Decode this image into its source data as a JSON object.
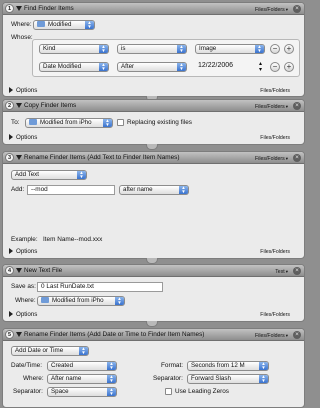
{
  "actions": [
    {
      "number": "1",
      "title": "Find Finder Items",
      "io": "Files/Folders",
      "where_label": "Where:",
      "where_value": "Modified",
      "whose_label": "Whose:",
      "conditions": [
        {
          "field": "Kind",
          "op": "is",
          "value": "Image"
        },
        {
          "field": "Date Modified",
          "op": "After",
          "value": "12/22/2006"
        }
      ],
      "options_label": "Options",
      "footer_io": "Files/Folders"
    },
    {
      "number": "2",
      "title": "Copy Finder Items",
      "io": "Files/Folders",
      "to_label": "To:",
      "to_value": "Modified from iPho",
      "replace_label": "Replacing existing files",
      "options_label": "Options",
      "footer_io": "Files/Folders"
    },
    {
      "number": "3",
      "title": "Rename Finder Items (Add Text to Finder Item Names)",
      "io": "Files/Folders",
      "mode": "Add Text",
      "add_label": "Add:",
      "add_value": "--mod",
      "position": "after name",
      "example_label": "Example:",
      "example_value": "Item Name--mod.xxx",
      "options_label": "Options",
      "footer_io": "Files/Folders"
    },
    {
      "number": "4",
      "title": "New Text File",
      "io": "Text",
      "save_as_label": "Save as:",
      "save_as_value": "0 Last RunDate.txt",
      "where_label": "Where:",
      "where_value": "Modified from iPho",
      "options_label": "Options",
      "footer_io": "Files/Folders"
    },
    {
      "number": "5",
      "title": "Rename Finder Items (Add Date or Time to Finder Item Names)",
      "io": "Files/Folders",
      "mode": "Add Date or Time",
      "date_time_label": "Date/Time:",
      "date_time_value": "Created",
      "format_label": "Format:",
      "format_value": "Seconds from 12 M",
      "where_label": "Where:",
      "where_value": "After name",
      "separator_label": "Separator:",
      "separator_value": "Forward Slash",
      "separator2_label": "Separator:",
      "separator2_value": "Space",
      "leading_zeros_label": "Use Leading Zeros"
    }
  ],
  "colors": {
    "window_bg": "#8f8f8f",
    "panel_bg": "#ebebeb",
    "popup_accent": "#3a73cf"
  }
}
